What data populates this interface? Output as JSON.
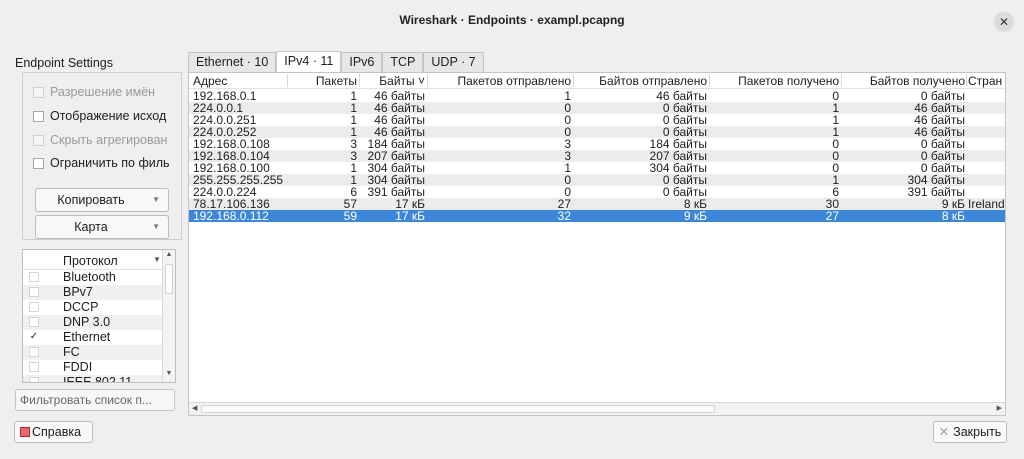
{
  "window": {
    "title": "Wireshark · Endpoints · exampl.pcapng"
  },
  "settings": {
    "title": "Endpoint Settings",
    "checkboxes": [
      {
        "label": "Разрешение имён",
        "checked": false,
        "enabled": false
      },
      {
        "label": "Отображение исход",
        "checked": false,
        "enabled": true
      },
      {
        "label": "Скрыть агрегирован",
        "checked": false,
        "enabled": false
      },
      {
        "label": "Ограничить по филь",
        "checked": false,
        "enabled": true
      }
    ],
    "copy_button": "Копировать",
    "map_button": "Карта",
    "protocol_header": "Протокол",
    "protocols": [
      {
        "name": "Bluetooth",
        "checked": false
      },
      {
        "name": "BPv7",
        "checked": false
      },
      {
        "name": "DCCP",
        "checked": false
      },
      {
        "name": "DNP 3.0",
        "checked": false
      },
      {
        "name": "Ethernet",
        "checked": true
      },
      {
        "name": "FC",
        "checked": false
      },
      {
        "name": "FDDI",
        "checked": false
      },
      {
        "name": "IEEE 802.11",
        "checked": false
      }
    ],
    "filter_placeholder": "Фильтровать список п..."
  },
  "tabs": [
    "Ethernet · 10",
    "IPv4 · 11",
    "IPv6",
    "TCP",
    "UDP · 7"
  ],
  "active_tab": 1,
  "table": {
    "columns": [
      "Адрес",
      "Пакеты",
      "Байты ˅",
      "Пакетов отправлено",
      "Байтов отправлено",
      "Пакетов получено",
      "Байтов получено",
      "Стран"
    ],
    "rows": [
      [
        "192.168.0.1",
        "1",
        "46 байты",
        "1",
        "46 байты",
        "0",
        "0 байты",
        ""
      ],
      [
        "224.0.0.1",
        "1",
        "46 байты",
        "0",
        "0 байты",
        "1",
        "46 байты",
        ""
      ],
      [
        "224.0.0.251",
        "1",
        "46 байты",
        "0",
        "0 байты",
        "1",
        "46 байты",
        ""
      ],
      [
        "224.0.0.252",
        "1",
        "46 байты",
        "0",
        "0 байты",
        "1",
        "46 байты",
        ""
      ],
      [
        "192.168.0.108",
        "3",
        "184 байты",
        "3",
        "184 байты",
        "0",
        "0 байты",
        ""
      ],
      [
        "192.168.0.104",
        "3",
        "207 байты",
        "3",
        "207 байты",
        "0",
        "0 байты",
        ""
      ],
      [
        "192.168.0.100",
        "1",
        "304 байты",
        "1",
        "304 байты",
        "0",
        "0 байты",
        ""
      ],
      [
        "255.255.255.255",
        "1",
        "304 байты",
        "0",
        "0 байты",
        "1",
        "304 байты",
        ""
      ],
      [
        "224.0.0.224",
        "6",
        "391 байты",
        "0",
        "0 байты",
        "6",
        "391 байты",
        ""
      ],
      [
        "78.17.106.136",
        "57",
        "17 кБ",
        "27",
        "8 кБ",
        "30",
        "9 кБ",
        "Ireland"
      ],
      [
        "192.168.0.112",
        "59",
        "17 кБ",
        "32",
        "9 кБ",
        "27",
        "8 кБ",
        ""
      ]
    ],
    "selected_row": 10
  },
  "footer": {
    "help_button": "Справка",
    "close_button": "Закрыть"
  }
}
